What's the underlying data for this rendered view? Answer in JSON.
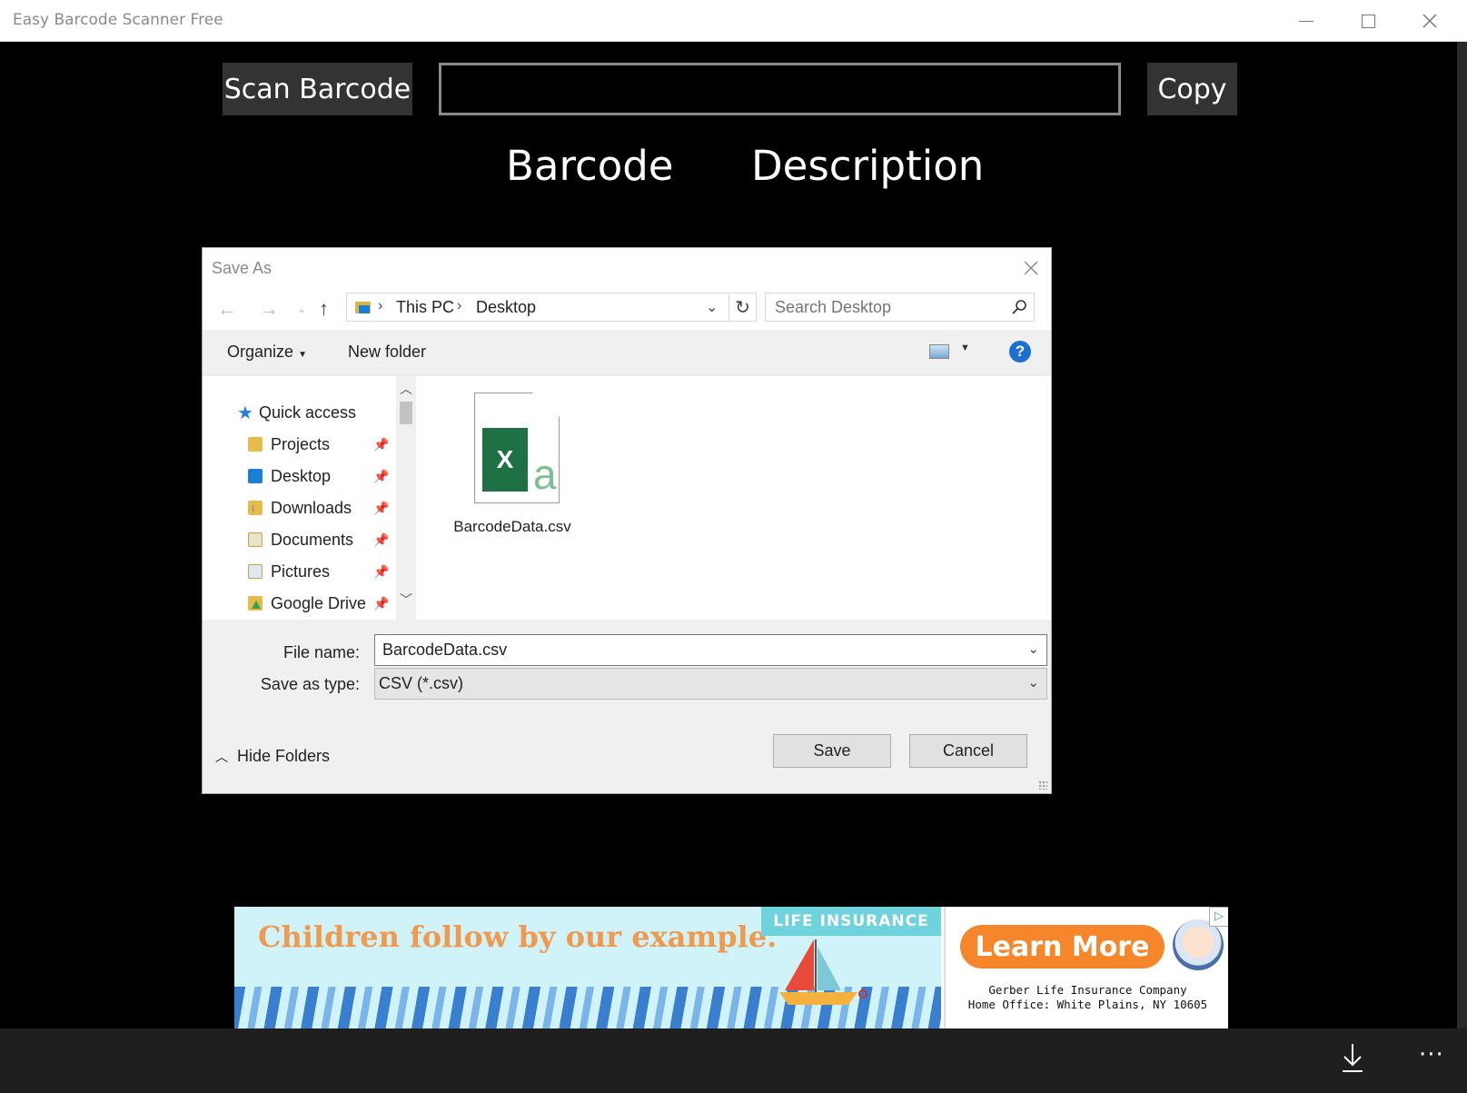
{
  "window": {
    "title": "Easy Barcode Scanner Free"
  },
  "toolbar": {
    "scan_label": "Scan Barcode",
    "barcode_value": "",
    "copy_label": "Copy"
  },
  "columns": {
    "barcode": "Barcode",
    "description": "Description"
  },
  "dialog": {
    "title": "Save As",
    "breadcrumb": [
      "This PC",
      "Desktop"
    ],
    "search_placeholder": "Search Desktop",
    "organize_label": "Organize",
    "new_folder_label": "New folder",
    "nav_items": [
      {
        "label": "Quick access",
        "icon": "star-icon"
      },
      {
        "label": "Projects",
        "icon": "folder-icon"
      },
      {
        "label": "Desktop",
        "icon": "desktop-folder-icon"
      },
      {
        "label": "Downloads",
        "icon": "downloads-folder-icon"
      },
      {
        "label": "Documents",
        "icon": "documents-folder-icon"
      },
      {
        "label": "Pictures",
        "icon": "pictures-folder-icon"
      },
      {
        "label": "Google Drive",
        "icon": "google-drive-folder-icon"
      }
    ],
    "files": [
      {
        "name": "BarcodeData.csv",
        "icon": "excel-csv-file-icon"
      }
    ],
    "file_name_label": "File name:",
    "file_name_value": "BarcodeData.csv",
    "save_type_label": "Save as type:",
    "save_type_value": "CSV (*.csv)",
    "hide_folders_label": "Hide Folders",
    "save_label": "Save",
    "cancel_label": "Cancel"
  },
  "ad": {
    "headline": "Children follow by our example.",
    "tag": "LIFE INSURANCE",
    "cta": "Learn More",
    "company_line1": "Gerber Life Insurance Company",
    "company_line2": "Home Office: White Plains, NY 10605"
  },
  "colors": {
    "app_background": "#000000",
    "button_dark": "#333333",
    "help_blue": "#1c6fd1",
    "excel_green": "#1e7145",
    "ad_orange": "#f5862a"
  }
}
